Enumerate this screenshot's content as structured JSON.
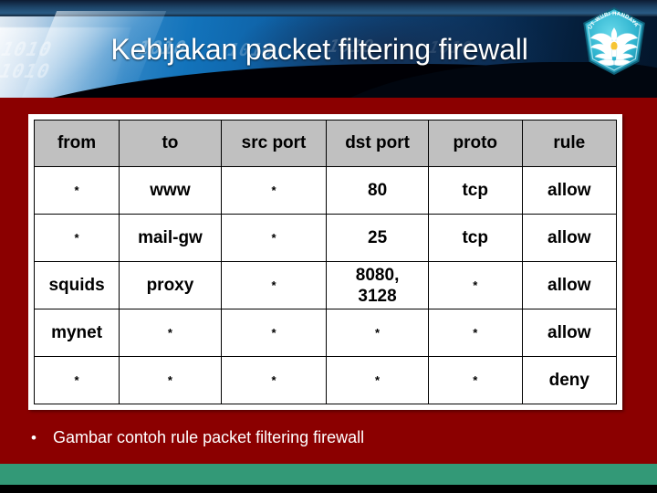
{
  "slide": {
    "title": "Kebijakan packet filtering firewall",
    "bullet_marker": "•",
    "bullet_text": "Gambar contoh rule packet filtering firewall",
    "colors": {
      "body_red": "#8b0000",
      "footer_green": "#339977",
      "header_gray": "#c0c0c0",
      "title_text": "#ffffff",
      "banner_blue": "#1273bb",
      "logo_cyan": "#2bb8d6"
    }
  },
  "banner": {
    "watermarks": [
      "1010",
      "1010",
      "1010",
      "1010",
      "1010",
      "1010"
    ],
    "logo_alt": "tut-wuri-handayani-logo"
  },
  "table": {
    "columns": [
      "from",
      "to",
      "src port",
      "dst port",
      "proto",
      "rule"
    ],
    "rows": [
      [
        "*",
        "www",
        "*",
        "80",
        "tcp",
        "allow"
      ],
      [
        "*",
        "mail-gw",
        "*",
        "25",
        "tcp",
        "allow"
      ],
      [
        "squids",
        "proxy",
        "*",
        "8080,\n3128",
        "*",
        "allow"
      ],
      [
        "mynet",
        "*",
        "*",
        "*",
        "*",
        "allow"
      ],
      [
        "*",
        "*",
        "*",
        "*",
        "*",
        "deny"
      ]
    ]
  }
}
